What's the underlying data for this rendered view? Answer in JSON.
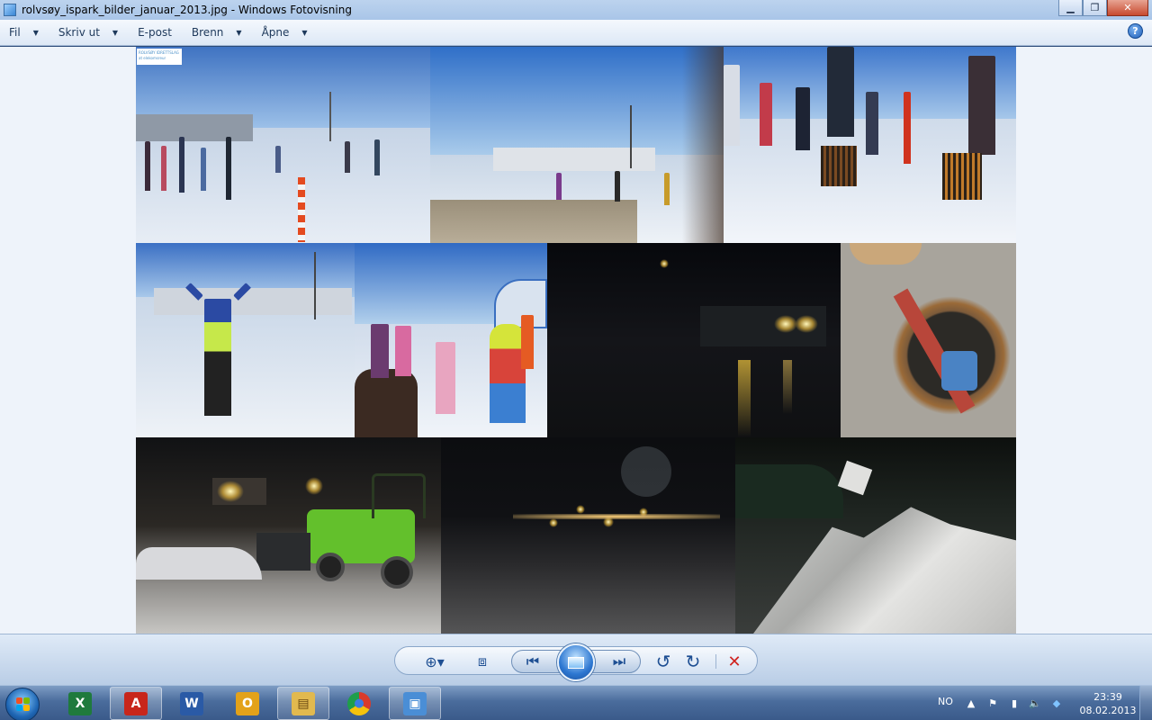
{
  "window": {
    "title": "rolvsøy_ispark_bilder_januar_2013.jpg - Windows Fotovisning",
    "minimize_icon": "minimize-icon",
    "maximize_icon": "restore-icon",
    "close_icon": "close-icon"
  },
  "menu": {
    "items": [
      {
        "label": "Fil",
        "has_dropdown": true
      },
      {
        "label": "Skriv ut",
        "has_dropdown": true
      },
      {
        "label": "E-post",
        "has_dropdown": false
      },
      {
        "label": "Brenn",
        "has_dropdown": true
      },
      {
        "label": "Åpne",
        "has_dropdown": true
      }
    ],
    "help_label": "?"
  },
  "photo": {
    "stamp_line1": "ROLVSØY IDRETTSLAG",
    "stamp_line2": "at elekomsreur"
  },
  "toolbar": {
    "buttons": [
      "zoom-icon",
      "fit-to-window-icon",
      "previous-icon",
      "slideshow-icon",
      "next-icon",
      "rotate-left-icon",
      "rotate-right-icon",
      "delete-icon"
    ],
    "zoom_glyph": "⊕▾",
    "fit_glyph": "⧈",
    "prev_glyph": "⏮",
    "next_glyph": "⏭",
    "rotl_glyph": "↺",
    "rotr_glyph": "↻",
    "delete_glyph": "✕",
    "delete_color": "#d0231f"
  },
  "taskbar": {
    "apps": [
      {
        "name": "excel",
        "glyph": "X",
        "color": "#1f7a3d"
      },
      {
        "name": "acrobat",
        "glyph": "A",
        "color": "#c8261b"
      },
      {
        "name": "word",
        "glyph": "W",
        "color": "#2a5aa6"
      },
      {
        "name": "outlook",
        "glyph": "O",
        "color": "#e3a21a"
      },
      {
        "name": "explorer",
        "glyph": "▤",
        "color": "#e1b94f"
      },
      {
        "name": "chrome",
        "glyph": "●",
        "color": "#d93b2b"
      },
      {
        "name": "photo-viewer",
        "glyph": "▣",
        "color": "#4a8ed6"
      }
    ],
    "language": "NO",
    "time": "23:39",
    "date": "08.02.2013"
  }
}
